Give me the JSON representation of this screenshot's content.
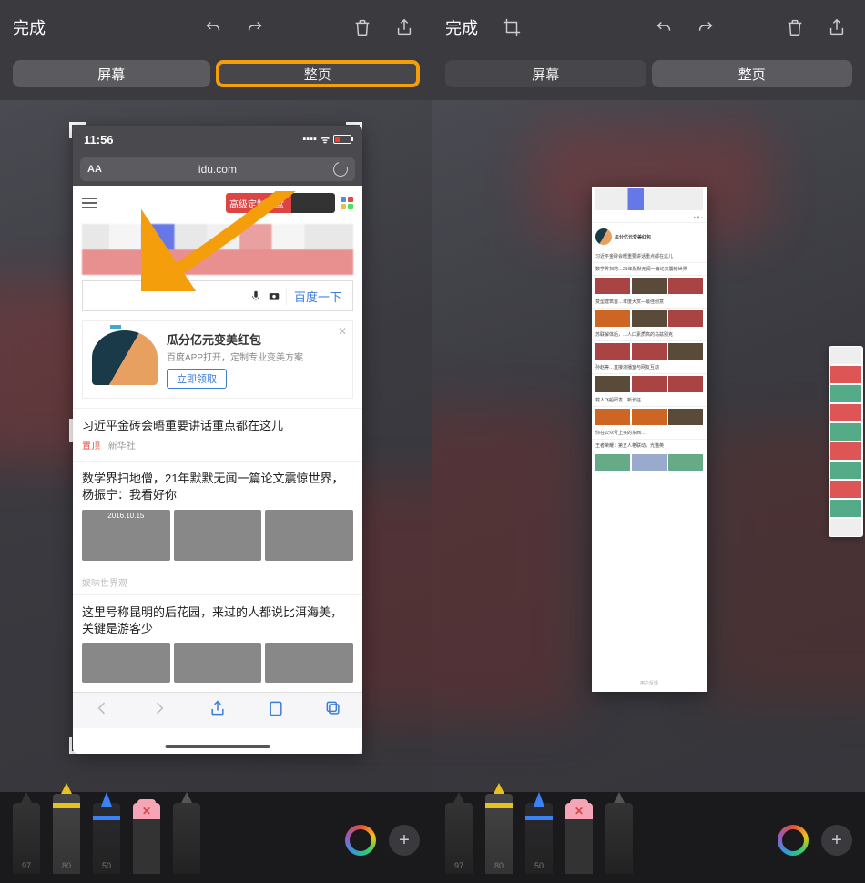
{
  "toolbar": {
    "done": "完成",
    "tabs": {
      "screen": "屏幕",
      "fullpage": "整页"
    }
  },
  "phone": {
    "time": "11:56",
    "url": "idu.com",
    "aa": "AA",
    "promo_banner": "高级定制礼盒",
    "search_button": "百度一下",
    "promo": {
      "title": "瓜分亿元变美红包",
      "subtitle": "百度APP打开，定制专业变美方案",
      "cta": "立即领取"
    },
    "news1": {
      "title": "习近平金砖会晤重要讲话重点都在这儿",
      "pin": "置顶",
      "source": "新华社"
    },
    "news2": {
      "title": "数学界扫地僧，21年默默无闻一篇论文震惊世界，杨振宁：我看好你",
      "date": "2016.10.15"
    },
    "feed_label": "娱味世界观",
    "news3": {
      "title": "这里号称昆明的后花园，来过的人都说比洱海美，关键是游客少"
    }
  },
  "longshot": {
    "promo_title": "瓜分亿元变美红包",
    "n1": "习近平金砖会晤重要讲话重点都在这儿",
    "n2": "数学界扫地…21年默默无闻一篇论文震惊世界",
    "n3": "变型建筑首…年度大赏—最佳创意",
    "n4": "苏联解体后，…人口素质高的乌兹别克",
    "n5": "孙赵等…直接演播室与网友互动",
    "n6": "载人飞船研发…新长征",
    "n7": "你在公众号上买的东西…",
    "n8": "王者荣耀：第五人格联动，光猫英",
    "foot": "用户反馈"
  },
  "tools": {
    "pen1_size": "97",
    "pen2_size": "80",
    "pen3_size": "50"
  }
}
